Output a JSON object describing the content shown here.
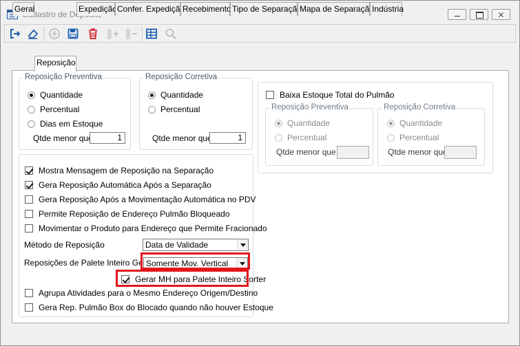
{
  "window": {
    "title": "Cadastro de Depósito"
  },
  "toolbar": {
    "buttons": [
      "exit-icon",
      "eraser-icon",
      "add-icon",
      "save-icon",
      "delete-icon",
      "add-rows-icon",
      "remove-rows-icon",
      "table-icon",
      "search-icon"
    ]
  },
  "tabs": [
    {
      "label": "Geral"
    },
    {
      "label": "Reposição"
    },
    {
      "label": "Expedição"
    },
    {
      "label": "Confer. Expedição"
    },
    {
      "label": "Recebimento"
    },
    {
      "label": "Tipo de Separação"
    },
    {
      "label": "Mapa de Separação"
    },
    {
      "label": "Indústria"
    }
  ],
  "preventiva": {
    "title": "Reposição Preventiva",
    "options": [
      "Quantidade",
      "Percentual",
      "Dias em Estoque"
    ],
    "selected_index": 0,
    "qtde_label": "Qtde menor que",
    "qtde_value": "1"
  },
  "corretiva": {
    "title": "Reposição Corretiva",
    "options": [
      "Quantidade",
      "Percentual"
    ],
    "selected_index": 0,
    "qtde_label": "Qtde menor que",
    "qtde_value": "1"
  },
  "pulmao": {
    "checkbox_label": "Baixa Estoque Total do Pulmão",
    "checked": false,
    "preventiva": {
      "title": "Reposição Preventiva",
      "options": [
        "Quantidade",
        "Percentual"
      ],
      "qtde_label": "Qtde menor que",
      "qtde_value": ""
    },
    "corretiva": {
      "title": "Reposição Corretiva",
      "options": [
        "Quantidade",
        "Percentual"
      ],
      "qtde_label": "Qtde menor que",
      "qtde_value": ""
    }
  },
  "options": {
    "mostra_mensagem": {
      "label": "Mostra Mensagem de Reposição na Separação",
      "checked": true
    },
    "gera_automatica": {
      "label": "Gera Reposição Automática Após a Separação",
      "checked": true
    },
    "gera_pdv": {
      "label": "Gera Reposição Após a Movimentação Automática no PDV",
      "checked": false
    },
    "permite_pulmao": {
      "label": "Permite Reposição de Endereço Pulmão Bloqueado",
      "checked": false
    },
    "movimentar_fracionado": {
      "label": "Movimentar o Produto para Endereço que Permite Fracionado",
      "checked": false
    },
    "metodo_label": "Método de Reposição",
    "metodo_value": "Data de Validade",
    "palete_label": "Reposições de Palete Inteiro Gerar",
    "palete_value": "Somente Mov. Vertical",
    "gerar_mh": {
      "label": "Gerar MH para Palete Inteiro Sorter",
      "checked": true
    },
    "agrupa": {
      "label": "Agrupa Atividades para o Mesmo Endereço Origem/Destino",
      "checked": false
    },
    "gera_pulmao_box": {
      "label": "Gera Rep. Pulmão Box do Blocado quando não houver Estoque",
      "checked": false
    }
  },
  "colors": {
    "highlight": "#e3161b",
    "group_border": "#d5dde5",
    "window_bg": "#f0f0f0"
  }
}
